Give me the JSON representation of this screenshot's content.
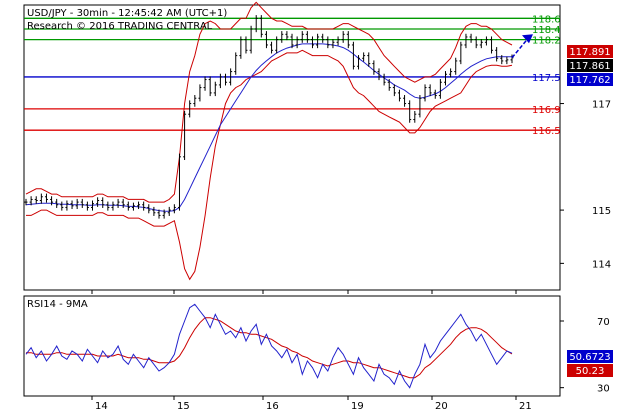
{
  "header": {
    "title": "USD/JPY - 30min - 12:45:42 AM (UTC+1)",
    "subtitle": "Research © 2016 TRADING CENTRAL"
  },
  "rsi_title": "RSI14 - 9MA",
  "colors": {
    "price": "#000000",
    "bollinger": "#cc0000",
    "ma": "#2222cc",
    "support": "#0000cc",
    "resistance_red": "#dd0000",
    "resistance_green": "#009900",
    "last_price_box": "#000000",
    "badge_red": "#cc0000",
    "badge_blue": "#0000cc"
  },
  "chart_data": [
    {
      "type": "line",
      "panel": "price",
      "x_tick_labels": [
        "14",
        "15",
        "16",
        "19",
        "20",
        "21"
      ],
      "y_ticks": [
        114,
        115,
        117
      ],
      "y_tick_labels": [
        "114",
        "115",
        "117"
      ],
      "ylim": [
        113.5,
        118.85
      ],
      "levels": [
        {
          "value": 118.6,
          "label": "118.6",
          "color": "#009900"
        },
        {
          "value": 118.4,
          "label": "118.4",
          "color": "#009900"
        },
        {
          "value": 118.2,
          "label": "118.2",
          "color": "#009900"
        },
        {
          "value": 117.5,
          "label": "117.5",
          "color": "#0000cc"
        },
        {
          "value": 116.9,
          "label": "116.9",
          "color": "#dd0000"
        },
        {
          "value": 116.5,
          "label": "116.5",
          "color": "#dd0000"
        }
      ],
      "badges": [
        {
          "value": 117.891,
          "label": "117.891",
          "color": "#cc0000"
        },
        {
          "value": 117.861,
          "label": "117.861",
          "color": "#000000"
        },
        {
          "value": 117.762,
          "label": "117.762",
          "color": "#0000cc"
        }
      ],
      "series": [
        {
          "kind": "price",
          "values": [
            115.15,
            115.2,
            115.18,
            115.25,
            115.2,
            115.15,
            115.1,
            115.05,
            115.12,
            115.08,
            115.15,
            115.1,
            115.05,
            115.12,
            115.18,
            115.1,
            115.05,
            115.1,
            115.15,
            115.1,
            115.05,
            115.08,
            115.1,
            115.05,
            115.0,
            114.95,
            114.9,
            114.95,
            115.0,
            115.05,
            116.0,
            116.8,
            117.0,
            117.1,
            117.3,
            117.45,
            117.2,
            117.35,
            117.5,
            117.4,
            117.6,
            117.9,
            118.2,
            118.0,
            118.4,
            118.6,
            118.3,
            118.1,
            118.0,
            118.2,
            118.3,
            118.25,
            118.1,
            118.2,
            118.3,
            118.2,
            118.1,
            118.25,
            118.2,
            118.1,
            118.15,
            118.2,
            118.3,
            118.1,
            117.7,
            117.85,
            117.9,
            117.75,
            117.6,
            117.5,
            117.4,
            117.3,
            117.2,
            117.1,
            117.0,
            116.7,
            116.8,
            117.1,
            117.3,
            117.2,
            117.15,
            117.4,
            117.55,
            117.6,
            117.8,
            118.1,
            118.25,
            118.2,
            118.1,
            118.15,
            118.2,
            118.0,
            117.85,
            117.8,
            117.82,
            117.86
          ]
        },
        {
          "kind": "bollinger_upper",
          "values": [
            115.3,
            115.35,
            115.4,
            115.4,
            115.35,
            115.3,
            115.3,
            115.25,
            115.25,
            115.25,
            115.25,
            115.25,
            115.25,
            115.25,
            115.3,
            115.3,
            115.25,
            115.25,
            115.25,
            115.25,
            115.2,
            115.2,
            115.2,
            115.2,
            115.15,
            115.15,
            115.15,
            115.15,
            115.2,
            115.3,
            116.0,
            117.0,
            117.6,
            117.9,
            118.3,
            118.5,
            118.55,
            118.5,
            118.4,
            118.4,
            118.4,
            118.5,
            118.6,
            118.6,
            118.8,
            118.9,
            118.8,
            118.7,
            118.6,
            118.55,
            118.55,
            118.5,
            118.45,
            118.45,
            118.45,
            118.4,
            118.4,
            118.4,
            118.4,
            118.4,
            118.4,
            118.45,
            118.5,
            118.5,
            118.45,
            118.4,
            118.35,
            118.3,
            118.2,
            118.05,
            117.9,
            117.8,
            117.7,
            117.6,
            117.5,
            117.45,
            117.4,
            117.45,
            117.5,
            117.5,
            117.55,
            117.65,
            117.75,
            117.85,
            118.05,
            118.3,
            118.45,
            118.5,
            118.5,
            118.45,
            118.45,
            118.4,
            118.3,
            118.2,
            118.15,
            118.1
          ]
        },
        {
          "kind": "bollinger_lower",
          "values": [
            114.9,
            114.9,
            114.95,
            115.0,
            115.0,
            114.95,
            114.9,
            114.9,
            114.9,
            114.9,
            114.9,
            114.9,
            114.9,
            114.9,
            114.95,
            114.95,
            114.9,
            114.9,
            114.9,
            114.9,
            114.85,
            114.85,
            114.85,
            114.8,
            114.75,
            114.7,
            114.7,
            114.7,
            114.75,
            114.8,
            114.4,
            113.9,
            113.7,
            113.85,
            114.3,
            114.9,
            115.6,
            116.2,
            116.6,
            117.0,
            117.2,
            117.3,
            117.35,
            117.45,
            117.5,
            117.55,
            117.6,
            117.7,
            117.8,
            117.85,
            117.9,
            117.95,
            117.95,
            117.95,
            118.0,
            117.95,
            117.9,
            117.9,
            117.9,
            117.9,
            117.85,
            117.8,
            117.7,
            117.5,
            117.3,
            117.2,
            117.15,
            117.05,
            116.95,
            116.85,
            116.8,
            116.75,
            116.7,
            116.65,
            116.55,
            116.45,
            116.45,
            116.55,
            116.7,
            116.85,
            116.95,
            117.0,
            117.05,
            117.1,
            117.15,
            117.2,
            117.35,
            117.5,
            117.6,
            117.65,
            117.7,
            117.72,
            117.72,
            117.7,
            117.7,
            117.72
          ]
        },
        {
          "kind": "moving_average",
          "values": [
            115.1,
            115.11,
            115.12,
            115.13,
            115.13,
            115.13,
            115.12,
            115.11,
            115.11,
            115.1,
            115.1,
            115.1,
            115.09,
            115.09,
            115.1,
            115.1,
            115.09,
            115.09,
            115.09,
            115.08,
            115.07,
            115.07,
            115.06,
            115.05,
            115.03,
            115.01,
            114.99,
            114.98,
            114.98,
            114.99,
            115.05,
            115.2,
            115.4,
            115.6,
            115.8,
            116.0,
            116.2,
            116.4,
            116.6,
            116.75,
            116.9,
            117.05,
            117.2,
            117.35,
            117.5,
            117.62,
            117.72,
            117.8,
            117.88,
            117.95,
            118.0,
            118.04,
            118.07,
            118.1,
            118.12,
            118.12,
            118.12,
            118.12,
            118.12,
            118.11,
            118.1,
            118.08,
            118.05,
            118.0,
            117.93,
            117.85,
            117.78,
            117.7,
            117.62,
            117.55,
            117.48,
            117.42,
            117.35,
            117.3,
            117.25,
            117.18,
            117.12,
            117.1,
            117.12,
            117.15,
            117.18,
            117.23,
            117.3,
            117.38,
            117.46,
            117.55,
            117.63,
            117.7,
            117.75,
            117.8,
            117.84,
            117.86,
            117.88,
            117.88,
            117.88,
            117.88
          ]
        }
      ]
    },
    {
      "type": "line",
      "panel": "rsi",
      "title": "RSI14 - 9MA",
      "ylim": [
        25,
        85
      ],
      "y_ticks": [
        30,
        70
      ],
      "y_tick_labels": [
        "30",
        "70"
      ],
      "badges": [
        {
          "value": 50.6723,
          "label": "50.6723",
          "color": "#0000cc"
        },
        {
          "value": 50.23,
          "label": "50.23",
          "color": "#cc0000"
        }
      ],
      "series": [
        {
          "kind": "rsi",
          "values": [
            50,
            54,
            48,
            52,
            46,
            50,
            55,
            49,
            47,
            52,
            50,
            46,
            53,
            49,
            45,
            52,
            48,
            50,
            55,
            47,
            44,
            50,
            46,
            42,
            48,
            44,
            40,
            42,
            45,
            50,
            62,
            70,
            78,
            80,
            76,
            72,
            66,
            74,
            68,
            62,
            64,
            60,
            66,
            58,
            64,
            68,
            56,
            62,
            55,
            52,
            48,
            53,
            45,
            50,
            38,
            46,
            42,
            36,
            44,
            40,
            48,
            54,
            50,
            44,
            38,
            48,
            42,
            38,
            34,
            44,
            38,
            36,
            32,
            40,
            34,
            30,
            38,
            44,
            56,
            48,
            52,
            58,
            62,
            66,
            70,
            74,
            68,
            64,
            58,
            62,
            56,
            50,
            44,
            48,
            52,
            50.67
          ]
        },
        {
          "kind": "rsi_ma",
          "values": [
            51,
            51,
            50,
            50,
            50,
            50,
            51,
            51,
            50,
            50,
            50,
            50,
            50,
            50,
            49,
            49,
            49,
            49,
            50,
            49,
            48,
            48,
            48,
            47,
            47,
            46,
            45,
            45,
            45,
            46,
            49,
            54,
            60,
            65,
            69,
            72,
            72,
            71,
            70,
            68,
            66,
            64,
            63,
            63,
            62,
            62,
            61,
            60,
            59,
            57,
            55,
            54,
            52,
            51,
            49,
            48,
            46,
            45,
            44,
            43,
            44,
            45,
            46,
            46,
            45,
            45,
            44,
            43,
            42,
            42,
            41,
            40,
            39,
            38,
            37,
            36,
            36,
            38,
            42,
            44,
            47,
            50,
            53,
            56,
            60,
            63,
            65,
            66,
            66,
            65,
            63,
            60,
            57,
            54,
            52,
            50.23
          ]
        }
      ]
    }
  ]
}
